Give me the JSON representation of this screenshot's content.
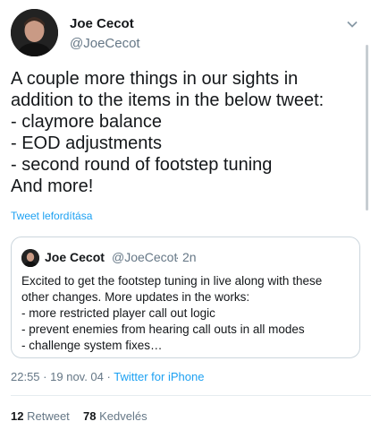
{
  "author": {
    "name": "Joe Cecot",
    "handle": "@JoeCecot"
  },
  "tweet": {
    "text": "A couple more things in our sights in addition to the items in the below tweet:\n- claymore balance\n- EOD adjustments\n- second round of footstep tuning\nAnd more!",
    "translate_label": "Tweet lefordítása"
  },
  "quoted_tweet": {
    "name": "Joe Cecot",
    "handle": "@JoeCecot",
    "separator": "·",
    "time": "2n",
    "text": "Excited to get the footstep tuning in live along with these other changes. More updates in the works:\n- more restricted player call out logic\n- prevent enemies from hearing call outs in all modes\n- challenge system fixes…"
  },
  "meta": {
    "time": "22:55",
    "separator": "·",
    "date": "19 nov. 04",
    "client": "Twitter for iPhone"
  },
  "stats": {
    "retweets_count": "12",
    "retweets_label": "Retweet",
    "likes_count": "78",
    "likes_label": "Kedvelés"
  },
  "icons": {
    "caret": "chevron-down-icon"
  },
  "colors": {
    "link": "#1da1f2",
    "secondary_text": "#657786",
    "border": "#ccd6dd"
  }
}
